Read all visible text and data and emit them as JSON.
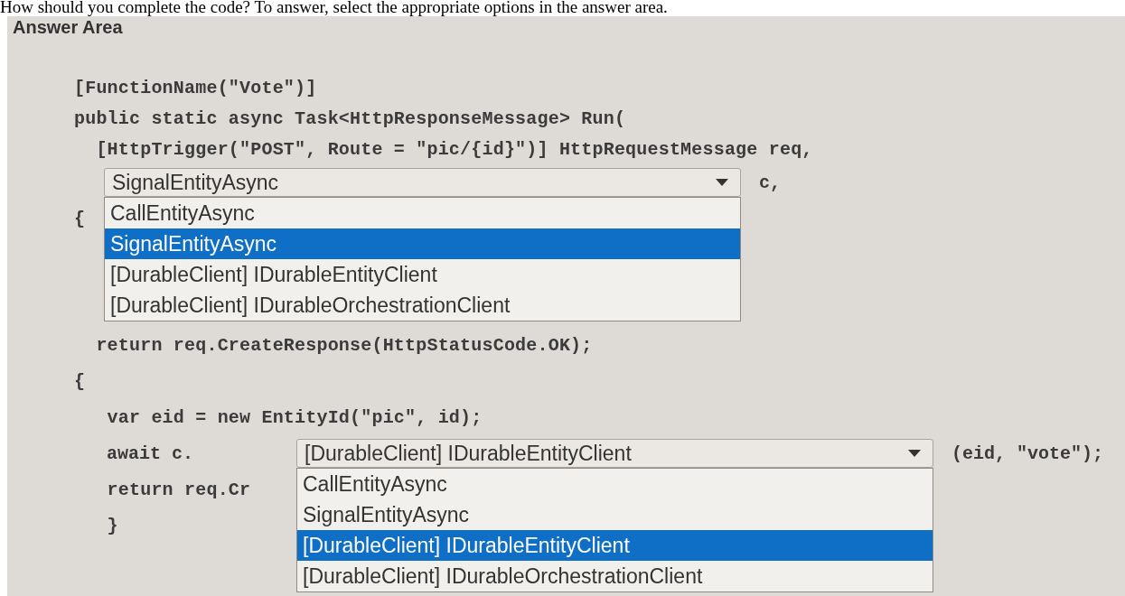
{
  "question": "How should you complete the code? To answer, select the appropriate options in the answer area.",
  "heading": "Answer Area",
  "code_lines": [
    {
      "kind": "text",
      "text": "[FunctionName(\"Vote\")]"
    },
    {
      "kind": "text",
      "text": "public static async Task<HttpResponseMessage> Run("
    },
    {
      "kind": "text",
      "text": "  [HttpTrigger(\"POST\", Route = \"pic/{id}\")] HttpRequestMessage req,"
    },
    {
      "kind": "dropdown",
      "value": "SignalEntityAsync",
      "suffix": "c,",
      "expanded": true,
      "options": [
        {
          "label": "CallEntityAsync",
          "selected": false
        },
        {
          "label": "SignalEntityAsync",
          "selected": true
        },
        {
          "label": "[DurableClient] IDurableEntityClient",
          "selected": false
        },
        {
          "label": "[DurableClient] IDurableOrchestrationClient",
          "selected": false
        }
      ]
    },
    {
      "kind": "text",
      "text": "{"
    },
    {
      "kind": "text",
      "text": "  return req.CreateResponse(HttpStatusCode.OK);"
    },
    {
      "kind": "text",
      "text": "{"
    },
    {
      "kind": "text",
      "text": "   var eid = new EntityId(\"pic\", id);"
    },
    {
      "kind": "dropdown",
      "prefix": "   await c.",
      "value": "[DurableClient] IDurableEntityClient",
      "suffix": "(eid, \"vote\");",
      "expanded": true,
      "options": [
        {
          "label": "CallEntityAsync",
          "selected": false
        },
        {
          "label": "SignalEntityAsync",
          "selected": false
        },
        {
          "label": "[DurableClient] IDurableEntityClient",
          "selected": true
        },
        {
          "label": "[DurableClient] IDurableOrchestrationClient",
          "selected": false
        }
      ]
    },
    {
      "kind": "text",
      "text": "   return req.Cr"
    },
    {
      "kind": "text",
      "text": "   }"
    }
  ]
}
